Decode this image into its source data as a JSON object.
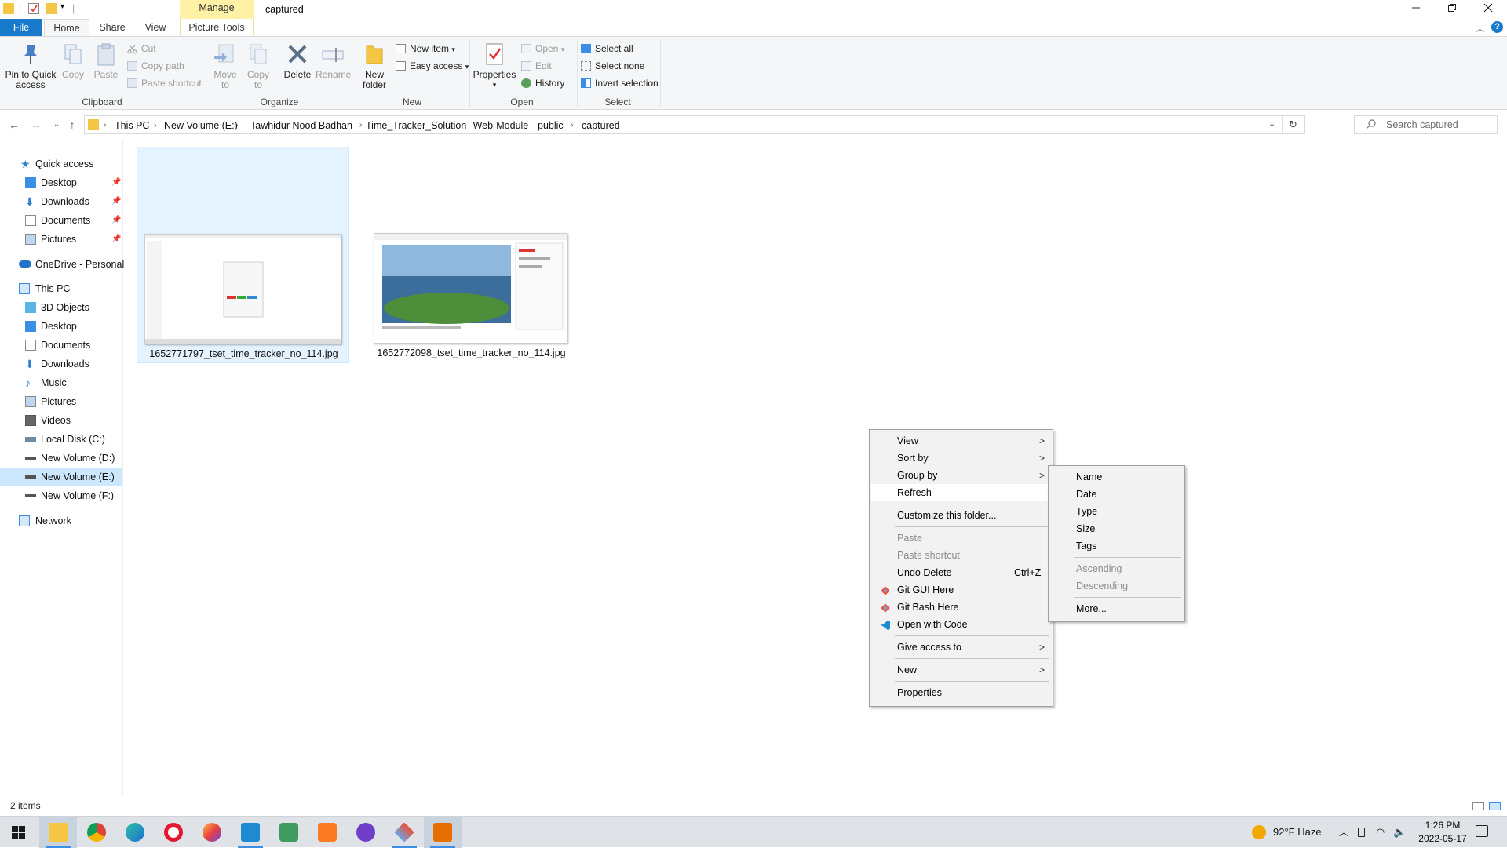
{
  "window": {
    "title": "captured",
    "context_tab": "Manage",
    "minimize_icon": "minimize-icon",
    "maximize_icon": "restore-icon",
    "close_icon": "close-icon",
    "help": "?"
  },
  "tabs": {
    "file": "File",
    "home": "Home",
    "share": "Share",
    "view": "View",
    "picture_tools": "Picture Tools"
  },
  "ribbon": {
    "clipboard": {
      "label": "Clipboard",
      "pin": [
        "Pin to Quick",
        "access"
      ],
      "copy": "Copy",
      "paste": "Paste",
      "cut": "Cut",
      "copy_path": "Copy path",
      "paste_shortcut": "Paste shortcut"
    },
    "organize": {
      "label": "Organize",
      "move_to": [
        "Move",
        "to"
      ],
      "copy_to": [
        "Copy",
        "to"
      ],
      "delete": "Delete",
      "rename": "Rename"
    },
    "new": {
      "label": "New",
      "new_folder": [
        "New",
        "folder"
      ],
      "new_item": "New item",
      "easy_access": "Easy access"
    },
    "open": {
      "label": "Open",
      "properties": "Properties",
      "open": "Open",
      "edit": "Edit",
      "history": "History"
    },
    "select": {
      "label": "Select",
      "select_all": "Select all",
      "select_none": "Select none",
      "invert": "Invert selection"
    }
  },
  "address": {
    "crumbs": [
      "This PC",
      "New Volume (E:)",
      "Tawhidur Nood Badhan",
      "Time_Tracker_Solution--Web-Module",
      "public",
      "captured"
    ],
    "search_placeholder": "Search captured"
  },
  "nav": {
    "quick_access": "Quick access",
    "quick_items": [
      "Desktop",
      "Downloads",
      "Documents",
      "Pictures"
    ],
    "onedrive": "OneDrive - Personal",
    "this_pc": "This PC",
    "pc_items": [
      "3D Objects",
      "Desktop",
      "Documents",
      "Downloads",
      "Music",
      "Pictures",
      "Videos",
      "Local Disk (C:)",
      "New Volume (D:)",
      "New Volume (E:)",
      "New Volume (F:)"
    ],
    "network": "Network"
  },
  "files": [
    {
      "name": "1652771797_tset_time_tracker_no_114.jpg"
    },
    {
      "name": "1652772098_tset_time_tracker_no_114.jpg"
    }
  ],
  "context_menu": {
    "view": "View",
    "sort_by": "Sort by",
    "group_by": "Group by",
    "refresh": "Refresh",
    "customize": "Customize this folder...",
    "paste": "Paste",
    "paste_shortcut": "Paste shortcut",
    "undo_delete": "Undo Delete",
    "undo_shortcut": "Ctrl+Z",
    "git_gui": "Git GUI Here",
    "git_bash": "Git Bash Here",
    "open_code": "Open with Code",
    "give_access": "Give access to",
    "new": "New",
    "properties": "Properties"
  },
  "submenu": {
    "name": "Name",
    "date": "Date",
    "type": "Type",
    "size": "Size",
    "tags": "Tags",
    "ascending": "Ascending",
    "descending": "Descending",
    "more": "More..."
  },
  "status": {
    "items": "2 items"
  },
  "taskbar": {
    "weather": "92°F  Haze",
    "time": "1:26 PM",
    "date": "2022-05-17",
    "apps": [
      "file-explorer-icon",
      "chrome-icon",
      "edge-icon",
      "opera-icon",
      "firefox-icon",
      "vscode-icon",
      "android-studio-icon",
      "xampp-icon",
      "github-desktop-icon",
      "gitkraken-icon",
      "java-icon"
    ]
  },
  "colors": {
    "accent": "#1979ca",
    "selection": "#cce8ff",
    "context_tab": "#fff2a6"
  }
}
